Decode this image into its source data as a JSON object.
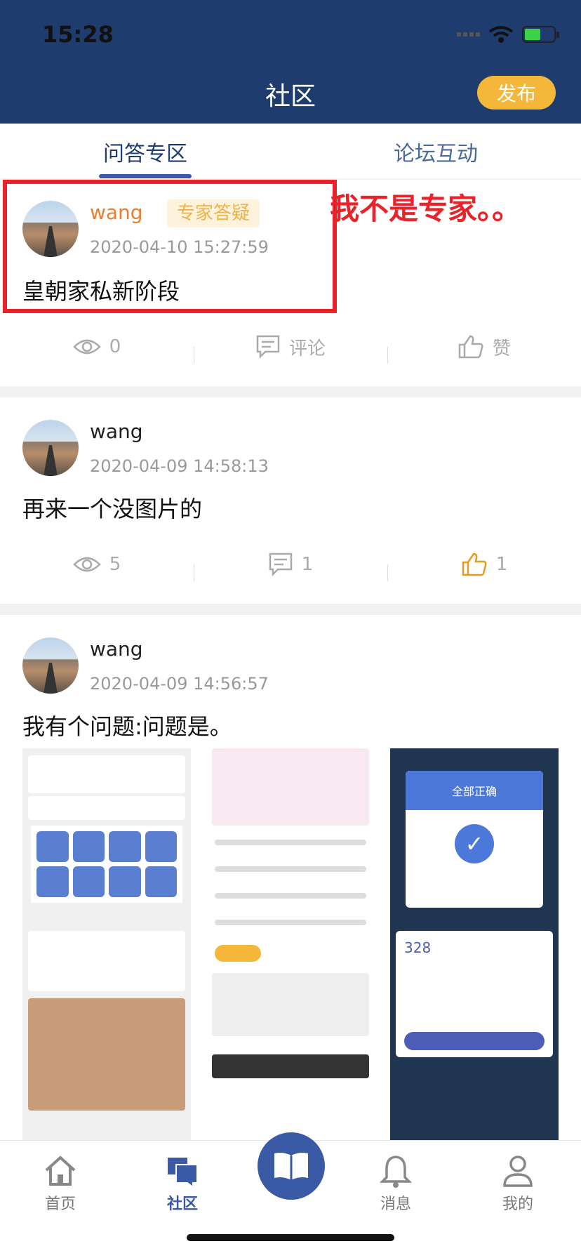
{
  "status_bar": {
    "time": "15:28"
  },
  "header": {
    "title": "社区",
    "publish_label": "发布"
  },
  "tabs": [
    {
      "label": "问答专区",
      "active": true
    },
    {
      "label": "论坛互动",
      "active": false
    }
  ],
  "annotation": {
    "text": "我不是专家。。"
  },
  "posts": [
    {
      "username": "wang",
      "tag": "专家答疑",
      "time": "2020-04-10 15:27:59",
      "content": "皇朝家私新阶段",
      "views": "0",
      "comments": "评论",
      "likes": "赞",
      "liked": false
    },
    {
      "username": "wang",
      "time": "2020-04-09 14:58:13",
      "content": "再来一个没图片的",
      "views": "5",
      "comments": "1",
      "likes": "1",
      "liked": true
    },
    {
      "username": "wang",
      "time": "2020-04-09 14:56:57",
      "content": "我有个问题:问题是。"
    }
  ],
  "thumbnails": [
    {
      "label": "profile-screenshot"
    },
    {
      "label": "home-screenshot"
    },
    {
      "label": "payment-screenshot",
      "title": "全部正确",
      "price": "328"
    }
  ],
  "tabbar": [
    {
      "label": "首页",
      "icon": "home-icon",
      "active": false
    },
    {
      "label": "社区",
      "icon": "community-icon",
      "active": true
    },
    {
      "label": "",
      "icon": "book-icon",
      "active": false
    },
    {
      "label": "消息",
      "icon": "bell-icon",
      "active": false
    },
    {
      "label": "我的",
      "icon": "user-icon",
      "active": false
    }
  ],
  "colors": {
    "header_bg": "#1f3c6e",
    "accent": "#3b5aa6",
    "publish": "#f5b73a",
    "annotation": "#e8242a"
  }
}
